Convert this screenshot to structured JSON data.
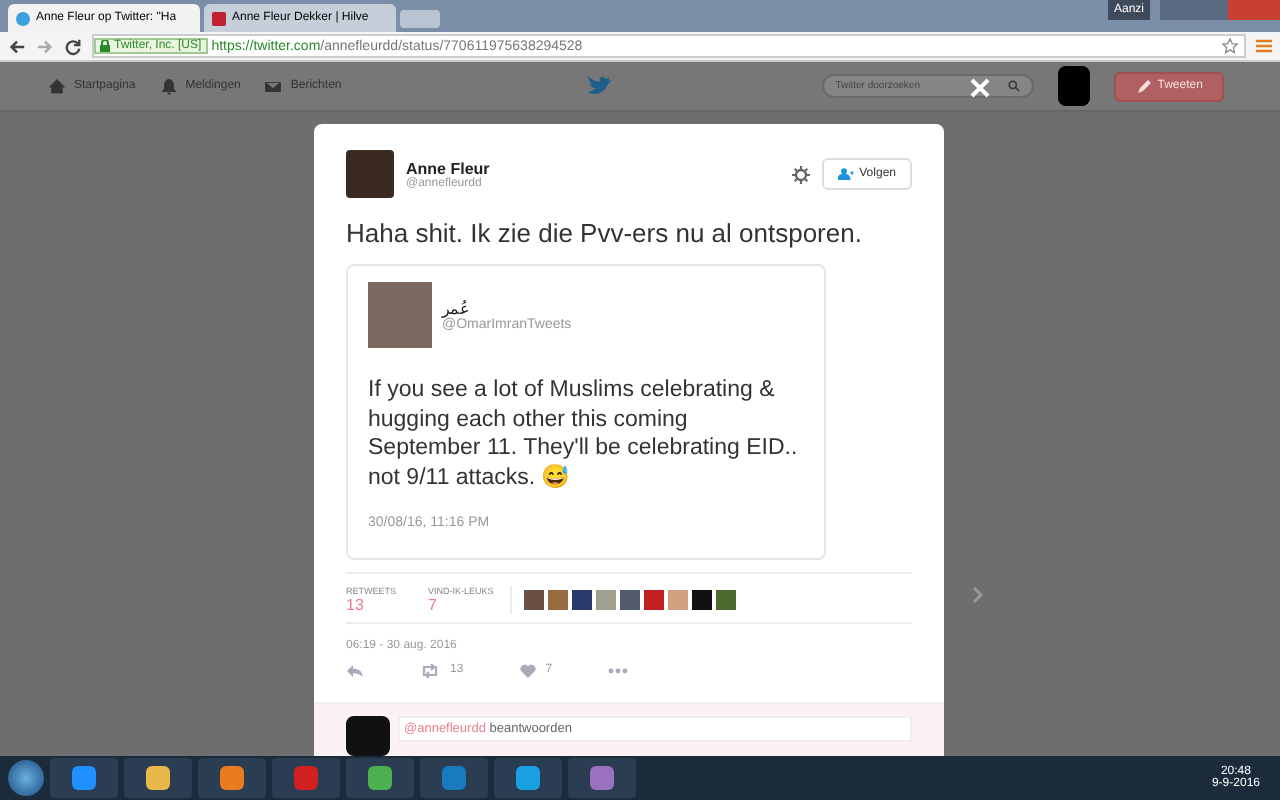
{
  "browser": {
    "tabs": [
      {
        "title": "Anne Fleur op Twitter: \"Ha",
        "selected": true
      },
      {
        "title": "Anne Fleur Dekker | Hilve",
        "selected": false
      }
    ],
    "window_button": "Aanzi",
    "secure_label": "Twitter, Inc. [US]",
    "url_host": "https://twitter.com",
    "url_path": "/annefleurdd/status/770611975638294528"
  },
  "nav": {
    "items": [
      "Startpagina",
      "Meldingen",
      "Berichten"
    ],
    "search": {
      "placeholder": "Twitter doorzoeken"
    },
    "tweet_button": "Tweeten"
  },
  "tweet": {
    "name": "Anne Fleur",
    "handle": "@annefleurdd",
    "follow_button": "Volgen",
    "text": "Haha shit. Ik zie die Pvv-ers nu al ontsporen.",
    "quote": {
      "name": "عُمر",
      "handle": "@OmarImranTweets",
      "text": "If you see a lot of Muslims celebrating & hugging each other this coming September 11. They'll be celebrating EID.. not 9/11 attacks. 😅",
      "date": "30/08/16, 11:16 PM"
    },
    "stats": [
      {
        "label": "RETWEETS",
        "value": "13"
      },
      {
        "label": "VIND-IK-LEUKS",
        "value": "7"
      }
    ],
    "timestamp": "06:19 - 30 aug. 2016",
    "retweet_count": "13",
    "like_count": "7",
    "reply": {
      "mention": "@annefleurdd",
      "text": "beantwoorden"
    }
  },
  "taskbar": {
    "time": "20:48",
    "date": "9-9-2016"
  }
}
